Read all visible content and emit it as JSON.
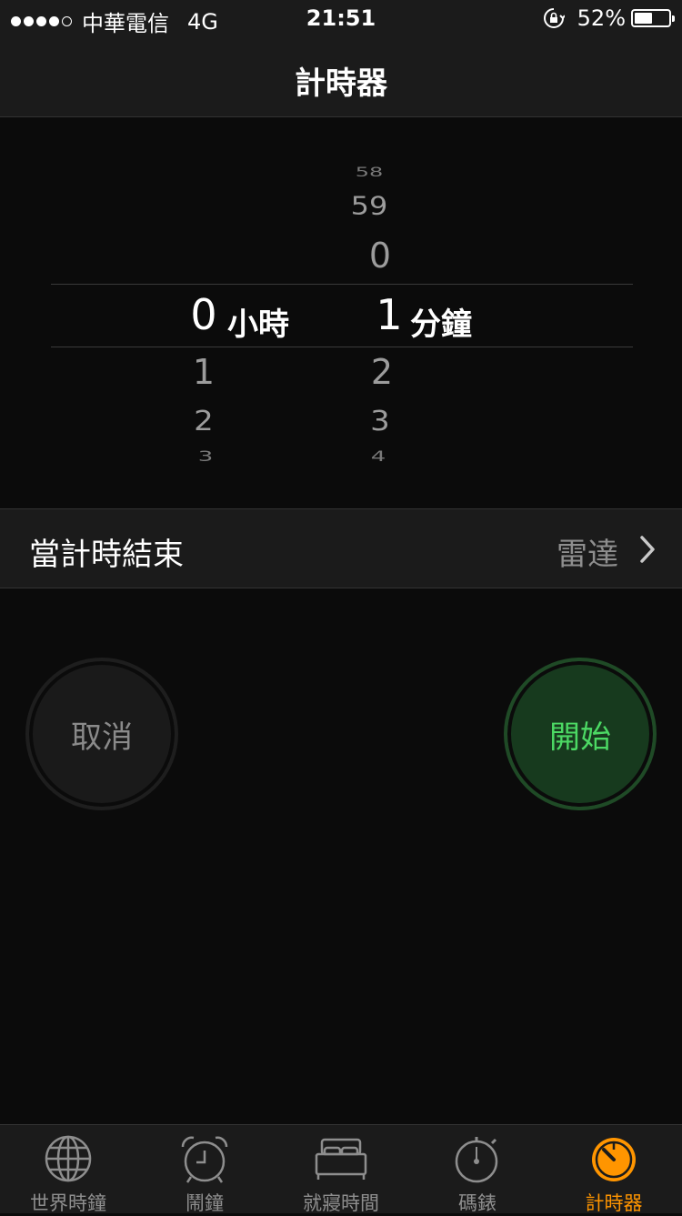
{
  "status_bar": {
    "carrier": "中華電信",
    "network": "4G",
    "time": "21:51",
    "battery": "52%",
    "battery_level": 0.52,
    "signal_bars": 4,
    "signal_total": 5,
    "icons": [
      "orientation-lock-icon",
      "battery-icon"
    ]
  },
  "nav": {
    "title": "計時器"
  },
  "picker": {
    "hours": {
      "above": [
        "",
        "",
        ""
      ],
      "selected": "0",
      "below": [
        "1",
        "2",
        "3"
      ],
      "unit": "小時"
    },
    "minutes": {
      "above": [
        "58",
        "59",
        "0"
      ],
      "selected": "1",
      "below": [
        "2",
        "3",
        "4"
      ],
      "unit": "分鐘"
    }
  },
  "sound_row": {
    "label": "當計時結束",
    "value": "雷達",
    "icon": "chevron-right-icon"
  },
  "buttons": {
    "cancel": "取消",
    "start": "開始"
  },
  "tabs": [
    {
      "label": "世界時鐘",
      "icon": "globe-icon",
      "active": false
    },
    {
      "label": "鬧鐘",
      "icon": "alarm-clock-icon",
      "active": false
    },
    {
      "label": "就寢時間",
      "icon": "bed-icon",
      "active": false
    },
    {
      "label": "碼錶",
      "icon": "stopwatch-icon",
      "active": false
    },
    {
      "label": "計時器",
      "icon": "timer-icon",
      "active": true
    }
  ],
  "colors": {
    "accent": "#ff9500",
    "start_green": "#4cd964",
    "background": "#0b0b0b",
    "bar": "#1b1b1b"
  }
}
